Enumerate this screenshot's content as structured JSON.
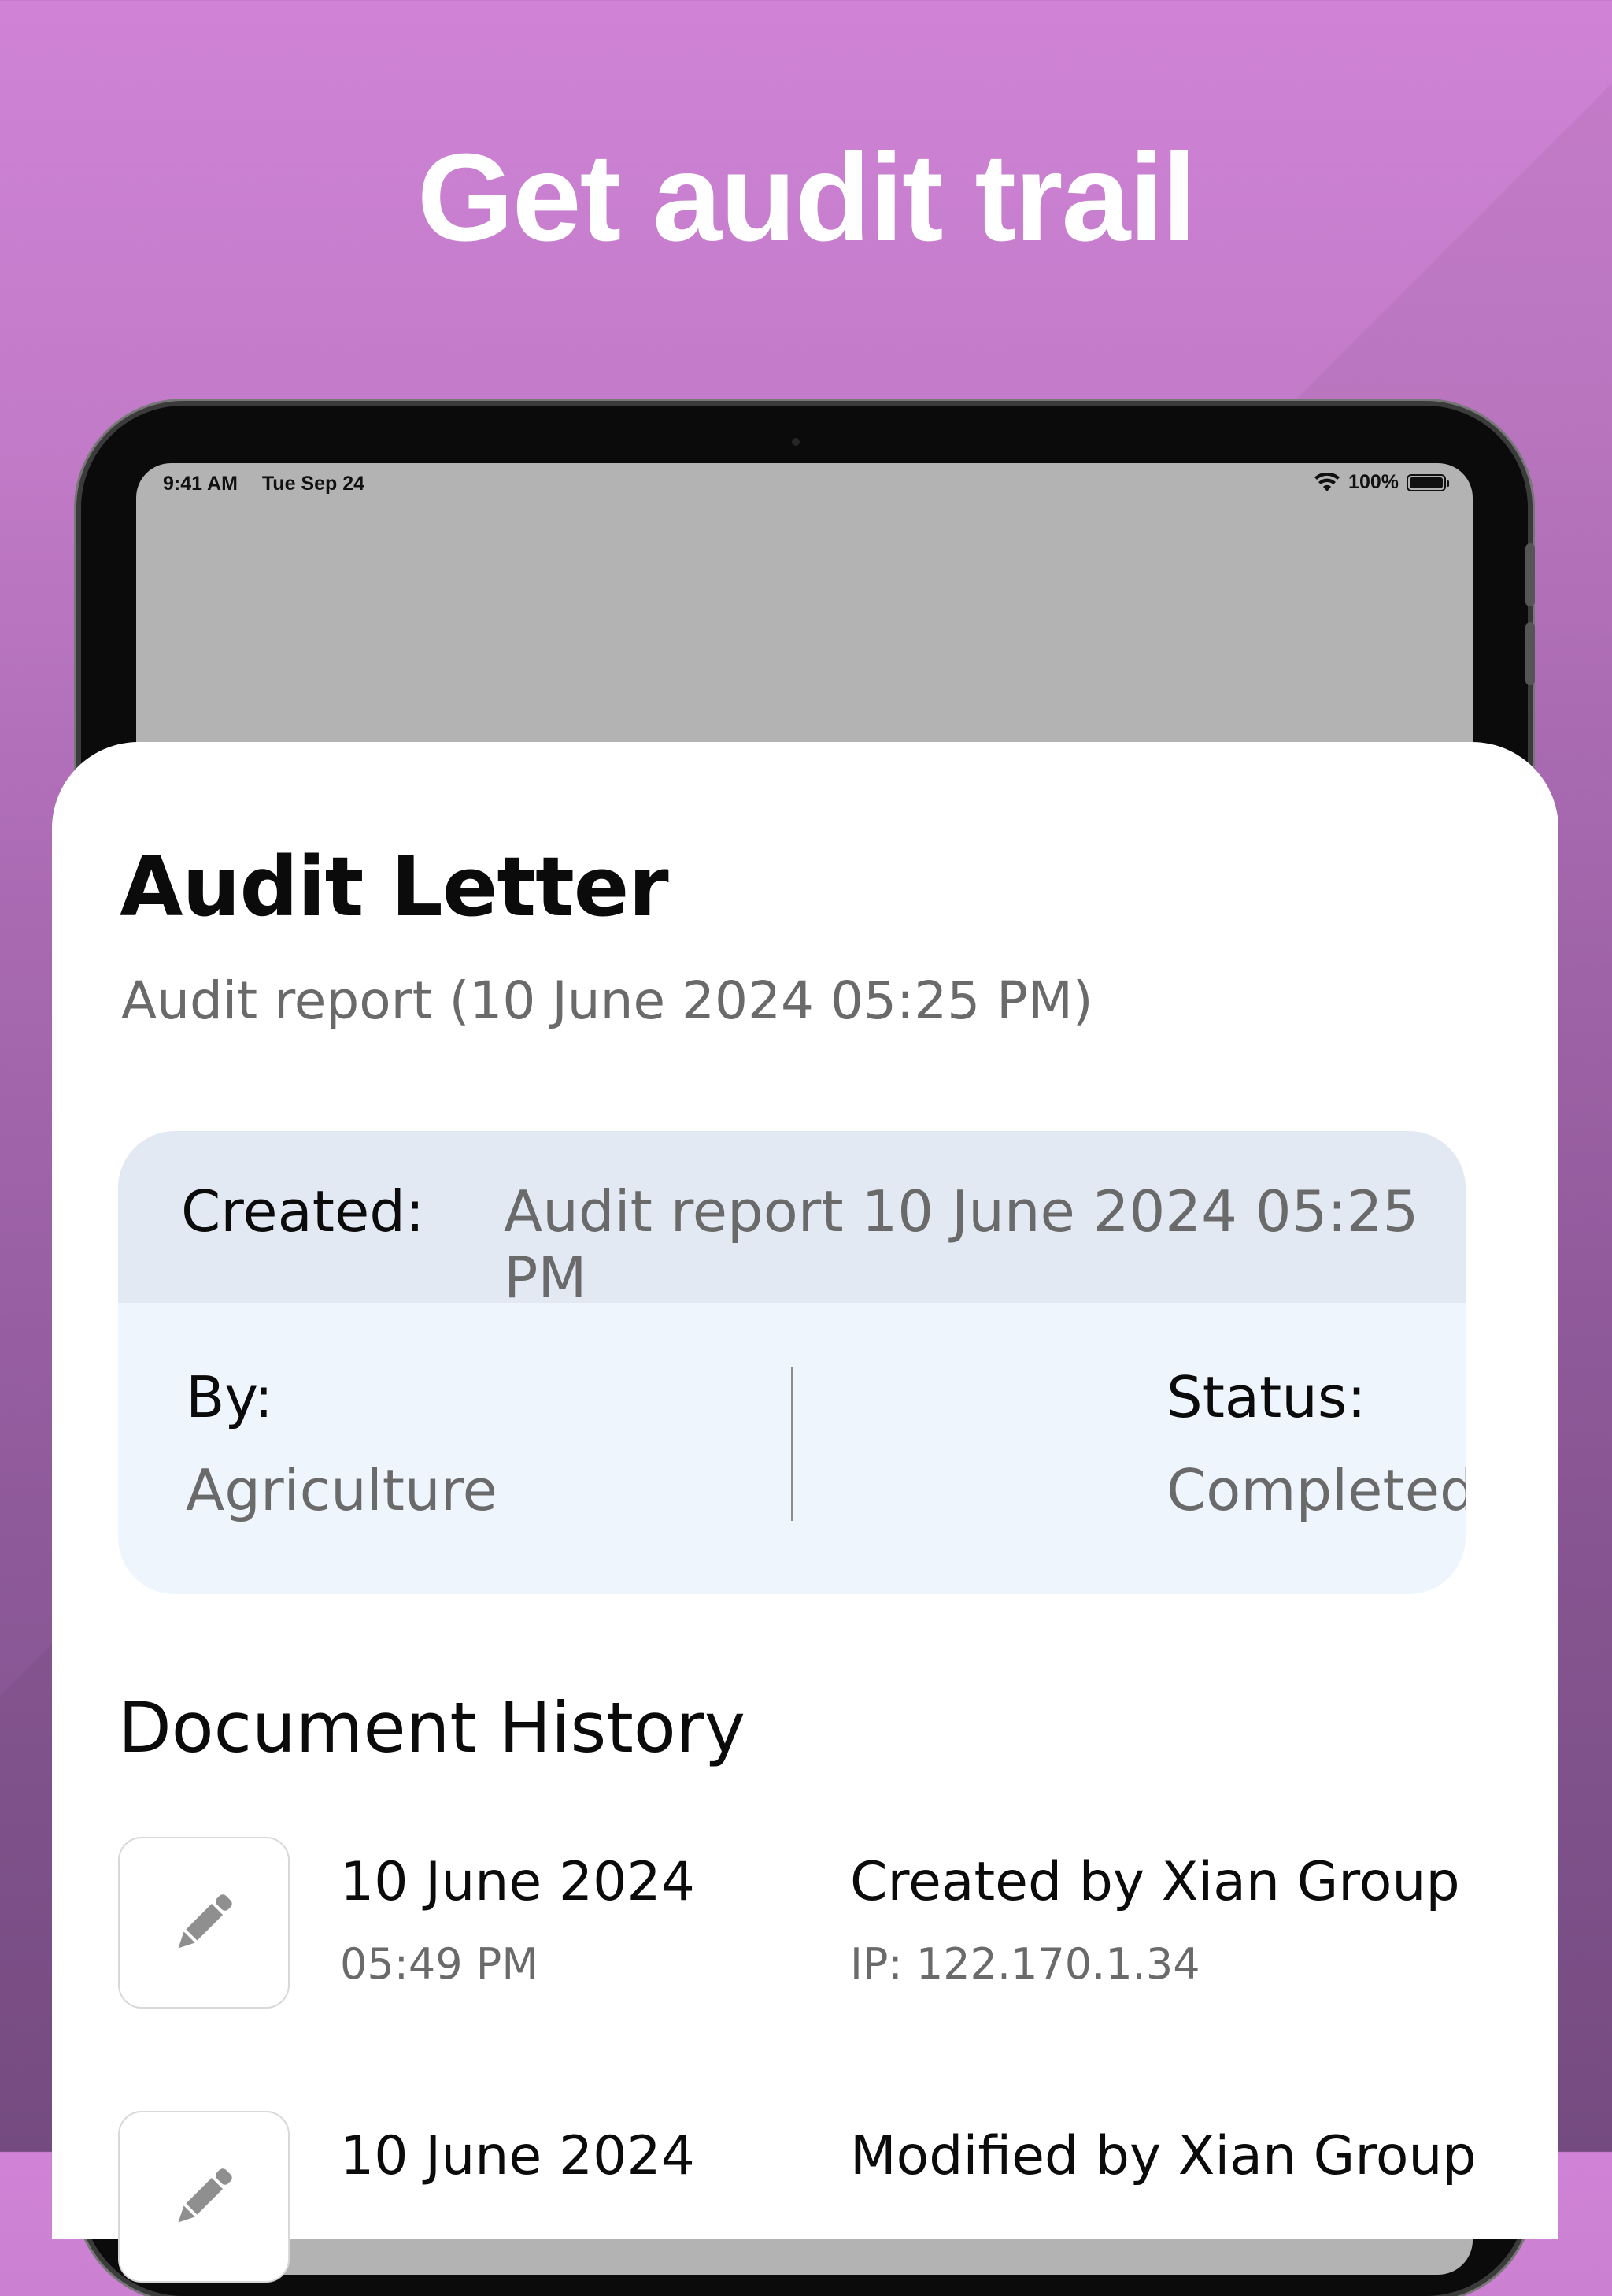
{
  "headline": "Get audit trail",
  "status_bar": {
    "time": "9:41 AM",
    "date": "Tue Sep 24",
    "battery": "100%"
  },
  "card": {
    "title": "Audit Letter",
    "subtitle": "Audit report (10 June 2024 05:25 PM)",
    "info": {
      "created_label": "Created:",
      "created_value": "Audit report 10 June 2024 05:25 PM",
      "by_label": "By:",
      "by_value": "Agriculture",
      "status_label": "Status:",
      "status_value": "Completed"
    },
    "history": {
      "title": "Document History",
      "items": [
        {
          "date": "10 June 2024",
          "time": "05:49 PM",
          "action": "Created by Xian Group",
          "ip": "IP: 122.170.1.34",
          "icon": "pencil-icon"
        },
        {
          "date": "10 June 2024",
          "time": "",
          "action": "Modified by Xian Group",
          "ip": "",
          "icon": "pencil-icon"
        }
      ]
    }
  },
  "colors": {
    "background_top": "#d083d6",
    "background_bottom": "#7a4f87",
    "info_header": "#e2e9f3",
    "info_body": "#eff5fd",
    "secondary_text": "#6a6a6a"
  }
}
